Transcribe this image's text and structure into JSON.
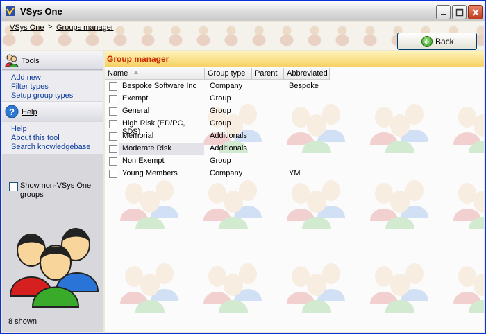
{
  "window": {
    "title": "VSys One"
  },
  "breadcrumb": {
    "items": [
      "VSys One",
      "Groups manager"
    ],
    "separator": ">"
  },
  "toolbar": {
    "back_label": "Back"
  },
  "left": {
    "tools_title": "Tools",
    "tools_links": [
      "Add new",
      "Filter types",
      "Setup group types"
    ],
    "help_title": "Help",
    "help_links": [
      "Help",
      "About this tool",
      "Search knowledgebase"
    ],
    "show_non_vsys": {
      "label": "Show non-VSys One groups",
      "checked": false
    },
    "count_text": "8 shown"
  },
  "grid": {
    "title": "Group manager",
    "columns": [
      "Name",
      "Group type",
      "Parent",
      "Abbreviated"
    ],
    "sort_column": "Name",
    "rows": [
      {
        "name": "Bespoke Software Inc",
        "type": "Company",
        "parent": "",
        "abbr": "Bespoke"
      },
      {
        "name": "Exempt",
        "type": "Group",
        "parent": "",
        "abbr": ""
      },
      {
        "name": "General",
        "type": "Group",
        "parent": "",
        "abbr": ""
      },
      {
        "name": "High Risk (ED/PC, SDS)",
        "type": "Group",
        "parent": "",
        "abbr": ""
      },
      {
        "name": "Memorial",
        "type": "Additionals",
        "parent": "",
        "abbr": ""
      },
      {
        "name": "Moderate Risk",
        "type": "Additionals",
        "parent": "",
        "abbr": ""
      },
      {
        "name": "Non Exempt",
        "type": "Group",
        "parent": "",
        "abbr": ""
      },
      {
        "name": "Young Members",
        "type": "Company",
        "parent": "",
        "abbr": "YM"
      }
    ]
  },
  "colors": {
    "title_accent": "#cc2a00",
    "header_gradient": "#f6d264",
    "link": "#0a3c9c"
  }
}
